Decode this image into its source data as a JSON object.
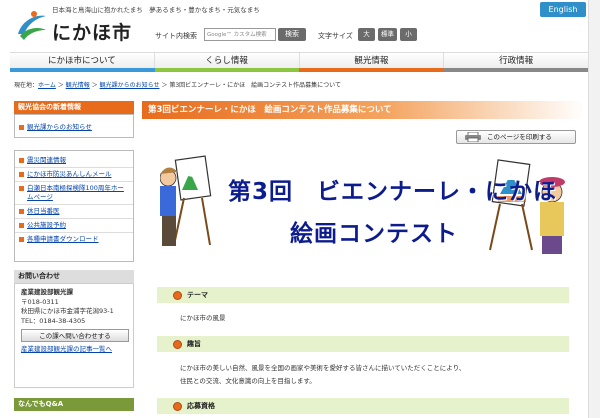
{
  "header": {
    "tagline": "日本海と鳥海山に抱かれたまち　夢あるまち・豊かなまち・元気なまち",
    "logo_text": "にかほ市",
    "english": "English",
    "search_label": "サイト内検索",
    "search_placeholder": "Google™ カスタム検索",
    "search_button": "検索",
    "textsize_label": "文字サイズ",
    "textsize": [
      "大",
      "標準",
      "小"
    ]
  },
  "nav": {
    "items": [
      "にかほ市について",
      "くらし情報",
      "観光情報",
      "行政情報"
    ],
    "bar_colors": [
      "#3a9ad9",
      "#8cc63f",
      "#e86b1c",
      "#888888"
    ]
  },
  "breadcrumb": {
    "prefix": "現在地：",
    "items": [
      "ホーム",
      "観光情報",
      "観光課からのお知らせ"
    ],
    "current": "第3回ビエンナーレ・にかほ　絵画コンテスト作品募集について",
    "sep": "＞"
  },
  "sidebar": {
    "kanko_head": "観光協会の新着情報",
    "kanko_link": "観光課からのお知らせ",
    "links": [
      "震災関連情報",
      "にかほ市防災あんしんメール",
      "白瀬日本南極探検隊100周年ホームページ",
      "休日当番医",
      "公共施設予約",
      "各種申請書ダウンロード"
    ],
    "contact_head": "お問い合わせ",
    "dept": "産業建設部観光課",
    "zip": "〒018-0311",
    "address": "秋田県にかほ市金浦字花潟93-1",
    "tel": "TEL：0184-38-4305",
    "contact_button": "この課へ問い合わせする",
    "articles_link": "産業建設部観光課の記事一覧へ",
    "qa_head": "なんでもQ&A"
  },
  "main": {
    "title": "第3回ビエンナーレ・にかほ　絵画コンテスト作品募集について",
    "print": "このページを印刷する",
    "banner_line1": "第3回　ビエンナーレ・にかほ",
    "banner_line2": "絵画コンテスト",
    "sections": [
      {
        "head": "テーマ",
        "text": [
          "にかほ市の風景"
        ]
      },
      {
        "head": "趣旨",
        "text": [
          "にかほ市の美しい自然、風景を全国の画家や美術を愛好する皆さんに描いていただくことにより、",
          "住民との交流、文化意識の向上を目指します。"
        ]
      },
      {
        "head": "応募資格",
        "text": []
      }
    ]
  }
}
